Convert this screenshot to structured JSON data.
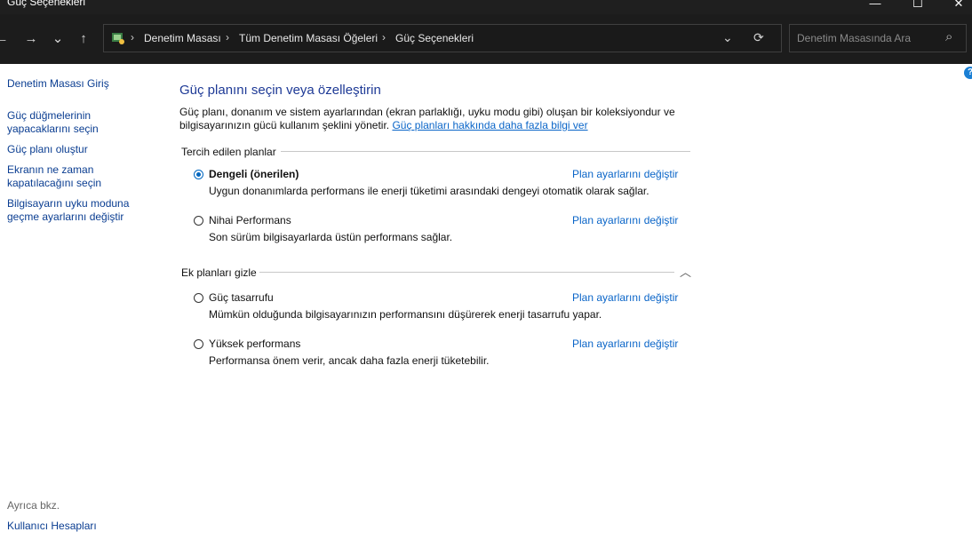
{
  "window": {
    "title": "Güç Seçenekleri",
    "minimize": "—",
    "maximize": "☐",
    "close": "✕"
  },
  "nav": {
    "back": "←",
    "forward": "→",
    "recent": "⌄",
    "up": "↑",
    "breadcrumbs": [
      "Denetim Masası",
      "Tüm Denetim Masası Öğeleri",
      "Güç Seçenekleri"
    ],
    "sep": "›",
    "dropdown": "⌄",
    "refresh": "⟳",
    "search_placeholder": "Denetim Masasında Ara",
    "search_icon": "⌕"
  },
  "sidebar": {
    "home": "Denetim Masası Giriş",
    "links": [
      "Güç düğmelerinin yapacaklarını seçin",
      "Güç planı oluştur",
      "Ekranın ne zaman kapatılacağını seçin",
      "Bilgisayarın uyku moduna geçme ayarlarını değiştir"
    ],
    "see_also": "Ayrıca bkz.",
    "user_accounts": "Kullanıcı Hesapları"
  },
  "main": {
    "title": "Güç planını seçin veya özelleştirin",
    "description": "Güç planı, donanım ve sistem ayarlarından (ekran parlaklığı, uyku modu gibi) oluşan bir koleksiyondur ve bilgisayarınızın gücü kullanım şeklini yönetir. ",
    "learn_more": "Güç planları hakkında daha fazla bilgi ver",
    "preferred_header": "Tercih edilen planlar",
    "extra_header": "Ek planları gizle",
    "change_link": "Plan ayarlarını değiştir",
    "plans": [
      {
        "name": "Dengeli (önerilen)",
        "desc": "Uygun donanımlarda performans ile enerji tüketimi arasındaki dengeyi otomatik olarak sağlar.",
        "selected": true
      },
      {
        "name": "Nihai Performans",
        "desc": "Son sürüm bilgisayarlarda üstün performans sağlar.",
        "selected": false
      },
      {
        "name": "Güç tasarrufu",
        "desc": "Mümkün olduğunda bilgisayarınızın performansını düşürerek enerji tasarrufu yapar.",
        "selected": false
      },
      {
        "name": "Yüksek performans",
        "desc": "Performansa önem verir, ancak daha fazla enerji tüketebilir.",
        "selected": false
      }
    ],
    "collapse_icon": "︿",
    "help_icon": "?"
  }
}
